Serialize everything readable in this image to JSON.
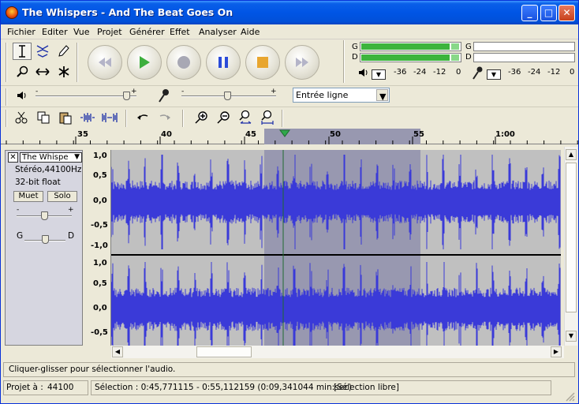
{
  "window": {
    "title": "The Whispers - And The Beat Goes On",
    "minimize": "_",
    "maximize": "□",
    "close": "✕"
  },
  "menu": [
    "Fichier",
    "Editer",
    "Vue",
    "Projet",
    "Générer",
    "Effet",
    "Analyser",
    "Aide"
  ],
  "tools": {
    "selection": "selection-tool",
    "envelope": "envelope-tool",
    "draw": "draw-tool",
    "zoom": "zoom-tool",
    "timeshift": "timeshift-tool",
    "multi": "multi-tool"
  },
  "transport": [
    "skip-start",
    "play",
    "record",
    "pause",
    "stop",
    "skip-end"
  ],
  "meters": {
    "play_channels": [
      "G",
      "D"
    ],
    "record_channels": [
      "G",
      "D"
    ],
    "play_level": 0.88,
    "play_scale": [
      "-36",
      "-24",
      "-12",
      "0"
    ],
    "record_scale": [
      "-36",
      "-24",
      "-12",
      "0"
    ]
  },
  "mixer": {
    "input_source": "Entrée ligne",
    "output_volume_level": 0.9,
    "input_volume_level": 0.48
  },
  "ruler": {
    "labels": [
      "35",
      "40",
      "45",
      "50",
      "55",
      "1:00"
    ]
  },
  "track": {
    "name": "The Whispe",
    "format": "Stéréo,44100Hz",
    "bits": "32-bit float",
    "mute": "Muet",
    "solo": "Solo",
    "gain_minus": "-",
    "gain_plus": "+",
    "pan_left": "G",
    "pan_right": "D",
    "gain_level": 0.5,
    "pan_level": 0.5,
    "scale_top": [
      "1,0",
      "0,5",
      "0,0",
      "-0,5",
      "-1,0"
    ],
    "scale_bottom": [
      "1,0",
      "0,5",
      "0,0",
      "-0,5"
    ]
  },
  "status": {
    "hint": "Cliquer-glisser pour sélectionner l'audio.",
    "rate_label": "Projet à :",
    "rate_value": "44100",
    "selection": "Sélection : 0:45,771115 - 0:55,112159 (0:09,341044 min:sec)",
    "snap": "[Sélection libre]"
  },
  "colors": {
    "waveform": "#3a3ad8",
    "selection": "#9898b0",
    "background": "#c0c0c0"
  }
}
